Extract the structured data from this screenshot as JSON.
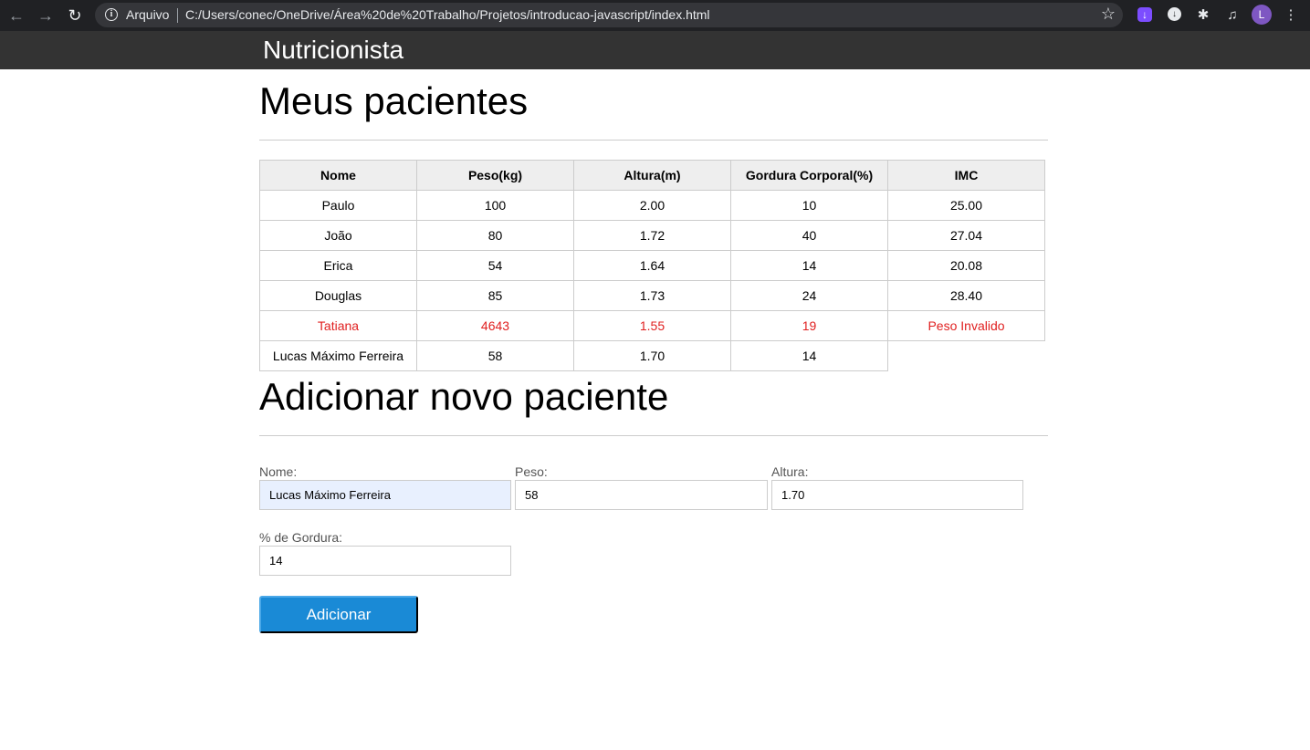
{
  "browser": {
    "origin_label": "Arquivo",
    "url": "C:/Users/conec/OneDrive/Área%20de%20Trabalho/Projetos/introducao-javascript/index.html",
    "avatar_initial": "L"
  },
  "header": {
    "title": "Nutricionista"
  },
  "patients_section": {
    "heading": "Meus pacientes",
    "columns": [
      "Nome",
      "Peso(kg)",
      "Altura(m)",
      "Gordura Corporal(%)",
      "IMC"
    ],
    "rows": [
      {
        "nome": "Paulo",
        "peso": "100",
        "altura": "2.00",
        "gordura": "10",
        "imc": "25.00",
        "invalid": false
      },
      {
        "nome": "João",
        "peso": "80",
        "altura": "1.72",
        "gordura": "40",
        "imc": "27.04",
        "invalid": false
      },
      {
        "nome": "Erica",
        "peso": "54",
        "altura": "1.64",
        "gordura": "14",
        "imc": "20.08",
        "invalid": false
      },
      {
        "nome": "Douglas",
        "peso": "85",
        "altura": "1.73",
        "gordura": "24",
        "imc": "28.40",
        "invalid": false
      },
      {
        "nome": "Tatiana",
        "peso": "4643",
        "altura": "1.55",
        "gordura": "19",
        "imc": "Peso Invalido",
        "invalid": true
      },
      {
        "nome": "Lucas Máximo Ferreira",
        "peso": "58",
        "altura": "1.70",
        "gordura": "14",
        "imc": "",
        "invalid": false
      }
    ],
    "invalid_color": "#e02020"
  },
  "form_section": {
    "heading": "Adicionar novo paciente",
    "nome": {
      "label": "Nome:",
      "value": "Lucas Máximo Ferreira"
    },
    "peso": {
      "label": "Peso:",
      "value": "58"
    },
    "altura": {
      "label": "Altura:",
      "value": "1.70"
    },
    "gordura": {
      "label": "% de Gordura:",
      "value": "14"
    },
    "submit_label": "Adicionar",
    "button_color": "#1a8ad6"
  }
}
